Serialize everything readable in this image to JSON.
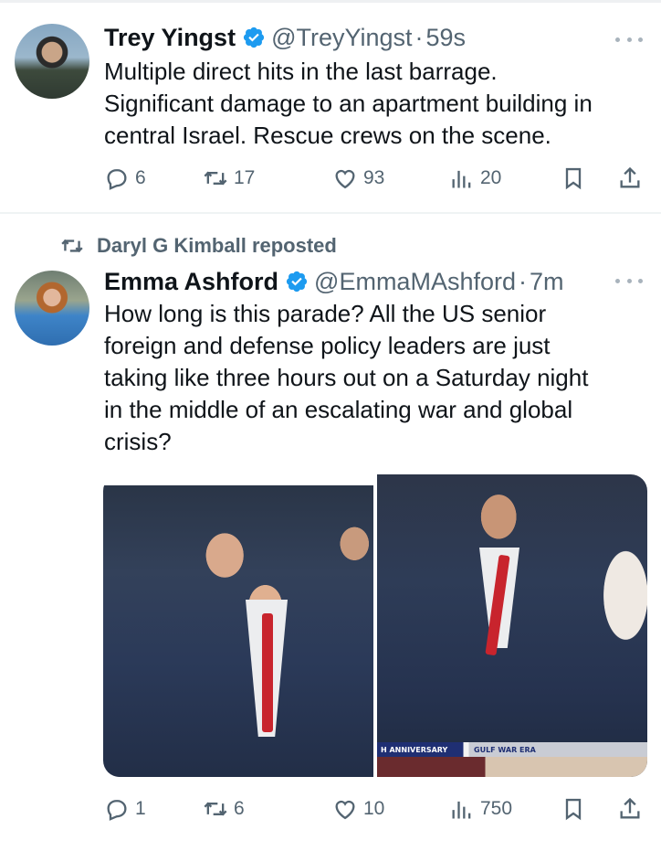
{
  "tweets": [
    {
      "author_name": "Trey Yingst",
      "handle": "@TreyYingst",
      "separator": "·",
      "time": "59s",
      "text": "Multiple direct hits in the last barrage.\nSignificant damage to an apartment building in\ncentral Israel. Rescue crews on the scene.",
      "replies": "6",
      "reposts": "17",
      "likes": "93",
      "views": "20"
    },
    {
      "reposted_by": "Daryl G Kimball reposted",
      "author_name": "Emma Ashford",
      "handle": "@EmmaMAshford",
      "separator": "·",
      "time": "7m",
      "text": "How long is this parade? All the US senior\nforeign and defense policy leaders are just\ntaking like three hours out on a Saturday night\nin the middle of an escalating war and global\ncrisis?",
      "media_ticker_left": "H ANNIVERSARY",
      "media_ticker_right": "GULF WAR ERA",
      "replies": "1",
      "reposts": "6",
      "likes": "10",
      "views": "750"
    }
  ],
  "colors": {
    "verified": "#1d9bf0",
    "secondary_text": "#536471",
    "primary_text": "#0f1419"
  },
  "icons": [
    "verified-badge-icon",
    "more-icon",
    "reply-icon",
    "repost-icon",
    "like-icon",
    "views-icon",
    "bookmark-icon",
    "share-icon"
  ]
}
